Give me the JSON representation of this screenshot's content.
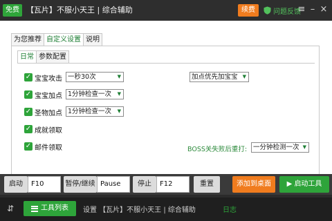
{
  "titlebar": {
    "free_badge": "免费",
    "title": "【瓦片】不服小天王 | 综合辅助",
    "renew_badge": "续费",
    "feedback": "问题反馈",
    "menu_icon": "menu-icon",
    "minimize_icon": "minimize-icon",
    "close_icon": "close-icon"
  },
  "tabs": [
    "为您推荐",
    "自定义设置",
    "说明"
  ],
  "active_tab": "自定义设置",
  "subtabs": [
    "日常",
    "参数配置"
  ],
  "active_subtab": "日常",
  "options": {
    "pet_attack": {
      "label": "宝宝攻击",
      "checked": true,
      "select": "一秒30次"
    },
    "pet_points": {
      "label": "宝宝加点",
      "checked": true,
      "select": "1分钟检查一次"
    },
    "holy_points": {
      "label": "圣物加点",
      "checked": true,
      "select": "1分钟检查一次"
    },
    "achievement": {
      "label": "成就领取",
      "checked": true
    },
    "mail": {
      "label": "邮件领取",
      "checked": true
    }
  },
  "priority_select": "加点优先加宝宝",
  "boss": {
    "label": "BOSS关失败后重打:",
    "select": "一分钟检测一次"
  },
  "controls": {
    "start_label": "启动",
    "start_key": "F10",
    "pause_label": "暂停/继续",
    "pause_key": "Pause",
    "stop_label": "停止",
    "stop_key": "F12",
    "reset_label": "重置",
    "add_desktop": "添加到桌面",
    "launch_tool": "启动工具"
  },
  "footer": {
    "menu_glyph": "⇵",
    "tools_button": "工具列表",
    "settings_text": "设置 【瓦片】不服小天王 | 综合辅助",
    "log_text": "日志"
  },
  "colors": {
    "green": "#2ea43a",
    "orange": "#f07c1e",
    "titlebar": "#2e2e2e",
    "footer": "#1f1f1f"
  }
}
